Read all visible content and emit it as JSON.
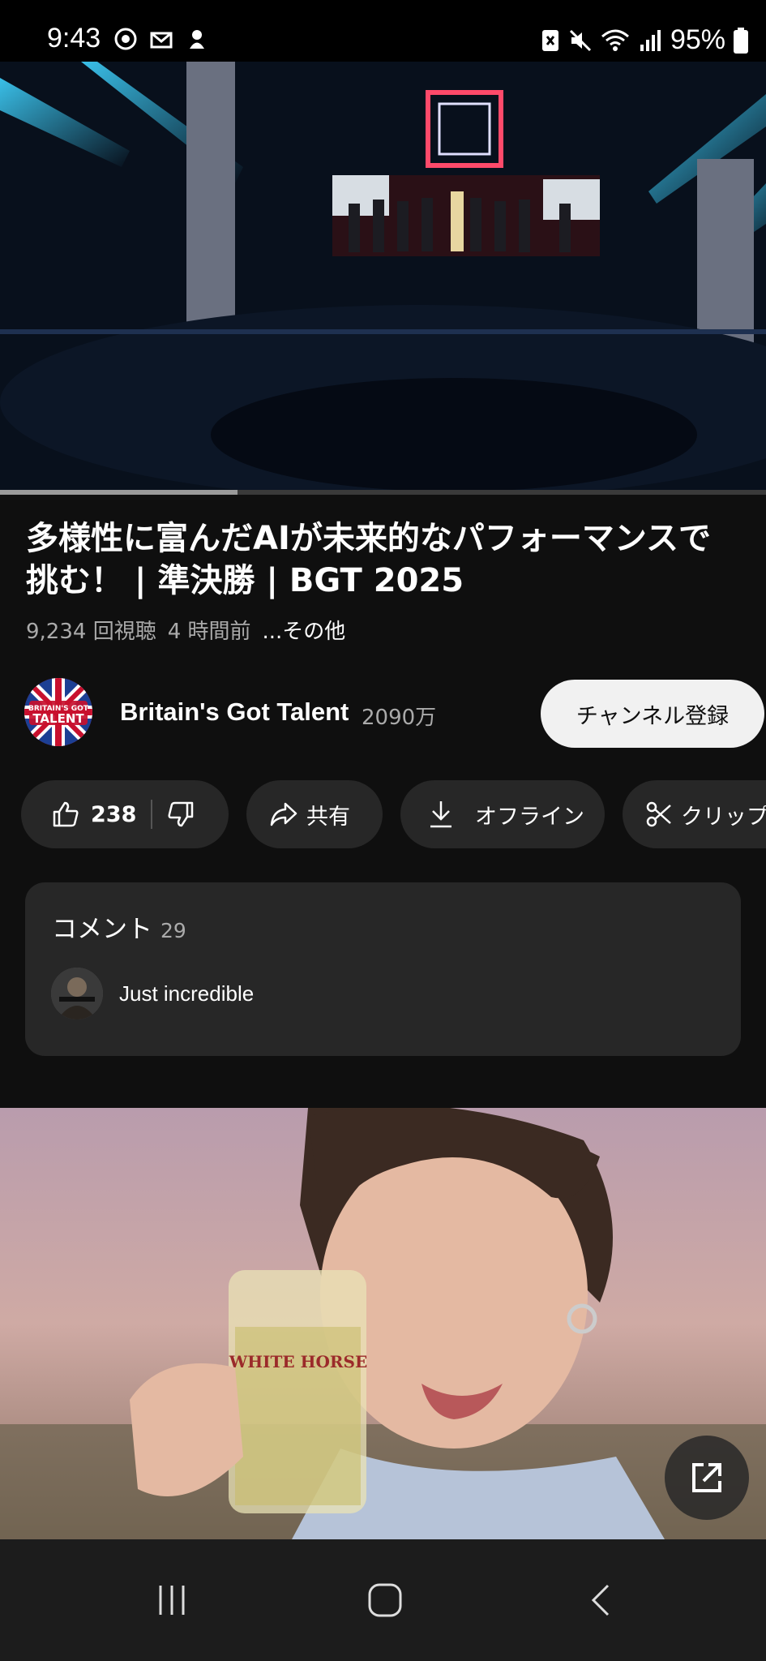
{
  "status_bar": {
    "time": "9:43",
    "battery": "95%",
    "left_icons": [
      "sync-icon",
      "mail-icon",
      "notification-icon"
    ],
    "right_icons": [
      "nfc-icon",
      "mute-icon",
      "wifi-icon",
      "signal-icon",
      "battery-icon"
    ]
  },
  "video": {
    "progress_fraction": 0.31,
    "title": "多様性に富んだAIが未来的なパフォーマンスで挑む！ | 準決勝 | BGT 2025",
    "views": "9,234 回視聴",
    "age": "4 時間前",
    "more": "...その他"
  },
  "channel": {
    "name": "Britain's Got Talent",
    "subscribers": "2090万",
    "subscribe_label": "チャンネル登録",
    "avatar_text_top": "BRITAIN'S GOT",
    "avatar_text_bottom": "TALENT"
  },
  "actions": {
    "likes": "238",
    "share": "共有",
    "download": "オフライン",
    "clip": "クリップ"
  },
  "comments": {
    "label": "コメント",
    "count": "29",
    "top_comment": "Just incredible"
  },
  "ad": {
    "brand_text": "WHITE HORSE"
  },
  "colors": {
    "background": "#0f0f0f",
    "pill": "#272727",
    "subscribe_bg": "#f1f1f1",
    "secondary_text": "#aaaaaa"
  }
}
